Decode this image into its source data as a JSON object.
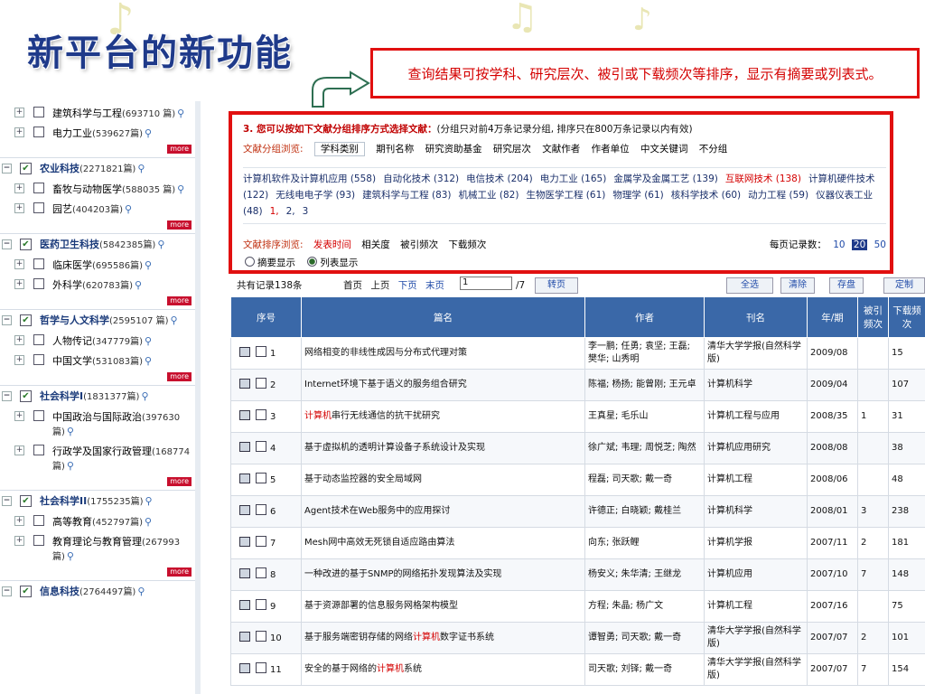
{
  "slide": {
    "title": "新平台的新功能",
    "callout": "查询结果可按学科、研究层次、被引或下载频次等排序，显示有摘要或列表式。"
  },
  "sidebar": {
    "items": [
      {
        "type": "sub",
        "name": "建筑科学与工程",
        "count": "(693710 篇)"
      },
      {
        "type": "sub",
        "name": "电力工业",
        "count": "(539627篇)"
      },
      {
        "type": "more",
        "label": "more"
      },
      {
        "type": "cat",
        "name": "农业科技",
        "count": "(2271821篇)"
      },
      {
        "type": "sub",
        "name": "畜牧与动物医学",
        "count": "(588035 篇)"
      },
      {
        "type": "sub",
        "name": "园艺",
        "count": "(404203篇)"
      },
      {
        "type": "more",
        "label": "more"
      },
      {
        "type": "cat",
        "name": "医药卫生科技",
        "count": "(5842385篇)"
      },
      {
        "type": "sub",
        "name": "临床医学",
        "count": "(695586篇)"
      },
      {
        "type": "sub",
        "name": "外科学",
        "count": "(620783篇)"
      },
      {
        "type": "more",
        "label": "more"
      },
      {
        "type": "cat",
        "name": "哲学与人文科学",
        "count": "(2595107 篇)"
      },
      {
        "type": "sub",
        "name": "人物传记",
        "count": "(347779篇)"
      },
      {
        "type": "sub",
        "name": "中国文学",
        "count": "(531083篇)"
      },
      {
        "type": "more",
        "label": "more"
      },
      {
        "type": "cat",
        "name": "社会科学I",
        "count": "(1831377篇)"
      },
      {
        "type": "sub",
        "name": "中国政治与国际政治",
        "count": "(397630 篇)"
      },
      {
        "type": "sub",
        "name": "行政学及国家行政管理",
        "count": "(168774篇)"
      },
      {
        "type": "more",
        "label": "more"
      },
      {
        "type": "cat",
        "name": "社会科学II",
        "count": "(1755235篇)"
      },
      {
        "type": "sub",
        "name": "高等教育",
        "count": "(452797篇)"
      },
      {
        "type": "sub",
        "name": "教育理论与教育管理",
        "count": "(267993 篇)"
      },
      {
        "type": "more",
        "label": "more"
      },
      {
        "type": "cat",
        "name": "信息科技",
        "count": "(2764497篇)"
      }
    ]
  },
  "panel": {
    "header_bold": "3. 您可以按如下文献分组排序方式选择文献：",
    "header_note": "(分组只对前4万条记录分组, 排序只在800万条记录以内有效)",
    "group_label": "文献分组浏览:",
    "group_tabs": [
      "学科类别",
      "期刊名称",
      "研究资助基金",
      "研究层次",
      "文献作者",
      "作者单位",
      "中文关键词",
      "不分组"
    ],
    "topics": [
      {
        "t": "计算机软件及计算机应用 (558)",
        "hl": false
      },
      {
        "t": "自动化技术 (312)",
        "hl": false
      },
      {
        "t": "电信技术 (204)",
        "hl": false
      },
      {
        "t": "电力工业 (165)",
        "hl": false
      },
      {
        "t": "金属学及金属工艺 (139)",
        "hl": false
      },
      {
        "t": "互联网技术 (138)",
        "hl": true
      },
      {
        "t": "计算机硬件技术 (122)",
        "hl": false
      },
      {
        "t": "无线电电子学 (93)",
        "hl": false
      },
      {
        "t": "建筑科学与工程 (83)",
        "hl": false
      },
      {
        "t": "机械工业 (82)",
        "hl": false
      },
      {
        "t": "生物医学工程 (61)",
        "hl": false
      },
      {
        "t": "物理学 (61)",
        "hl": false
      },
      {
        "t": "核科学技术 (60)",
        "hl": false
      },
      {
        "t": "动力工程 (59)",
        "hl": false
      },
      {
        "t": "仪器仪表工业 (48)",
        "hl": false
      },
      {
        "t": "1,",
        "hl": true
      },
      {
        "t": "2,",
        "hl": false
      },
      {
        "t": "3",
        "hl": false
      }
    ],
    "sort_label": "文献排序浏览:",
    "sort_options": [
      "发表时间",
      "相关度",
      "被引频次",
      "下载频次"
    ],
    "per_page_label": "每页记录数：",
    "per_page_options": [
      "10",
      "20",
      "50"
    ],
    "per_page_selected": "20",
    "view_abstract": "摘要显示",
    "view_list": "列表显示"
  },
  "pager": {
    "total": "共有记录138条",
    "first": "首页",
    "prev": "上页",
    "next": "下页",
    "last": "末页",
    "page_value": "1",
    "of": "/7",
    "go": "转页",
    "select_all": "全选",
    "clear": "清除",
    "save": "存盘",
    "custom": "定制"
  },
  "table": {
    "headers": [
      "序号",
      "篇名",
      "作者",
      "刊名",
      "年/期",
      "被引频次",
      "下载频次"
    ],
    "rows": [
      {
        "no": "1",
        "pre": "",
        "hl": "",
        "post": "网络相变的非线性成因与分布式代理对策",
        "authors": "李一鹏; 任勇; 袁坚; 王磊; 樊华; 山秀明",
        "journal": "清华大学学报(自然科学版)",
        "issue": "2009/08",
        "cited": "",
        "dl": "15"
      },
      {
        "no": "2",
        "pre": "",
        "hl": "",
        "post": "Internet环境下基于语义的服务组合研究",
        "authors": "陈福; 杨扬; 能曾刚; 王元卓",
        "journal": "计算机科学",
        "issue": "2009/04",
        "cited": "",
        "dl": "107"
      },
      {
        "no": "3",
        "pre": "",
        "hl": "计算机",
        "post": "串行无线通信的抗干扰研究",
        "authors": "王真星; 毛乐山",
        "journal": "计算机工程与应用",
        "issue": "2008/35",
        "cited": "1",
        "dl": "31"
      },
      {
        "no": "4",
        "pre": "",
        "hl": "",
        "post": "基于虚拟机的透明计算设备子系统设计及实现",
        "authors": "徐广斌; 韦理; 周悦芝; 陶然",
        "journal": "计算机应用研究",
        "issue": "2008/08",
        "cited": "",
        "dl": "38"
      },
      {
        "no": "5",
        "pre": "",
        "hl": "",
        "post": "基于动态监控器的安全局域网",
        "authors": "程磊; 司天歌; 戴一奇",
        "journal": "计算机工程",
        "issue": "2008/06",
        "cited": "",
        "dl": "48"
      },
      {
        "no": "6",
        "pre": "",
        "hl": "",
        "post": "Agent技术在Web服务中的应用探讨",
        "authors": "许德正; 白晓颖; 戴桂兰",
        "journal": "计算机科学",
        "issue": "2008/01",
        "cited": "3",
        "dl": "238"
      },
      {
        "no": "7",
        "pre": "",
        "hl": "",
        "post": "Mesh网中高效无死锁自适应路由算法",
        "authors": "向东; 张跃鲤",
        "journal": "计算机学报",
        "issue": "2007/11",
        "cited": "2",
        "dl": "181"
      },
      {
        "no": "8",
        "pre": "",
        "hl": "",
        "post": "一种改进的基于SNMP的网络拓扑发现算法及实现",
        "authors": "杨安义; 朱华清; 王继龙",
        "journal": "计算机应用",
        "issue": "2007/10",
        "cited": "7",
        "dl": "148"
      },
      {
        "no": "9",
        "pre": "",
        "hl": "",
        "post": "基于资源部署的信息服务网格架构模型",
        "authors": "方程; 朱晶; 杨广文",
        "journal": "计算机工程",
        "issue": "2007/16",
        "cited": "",
        "dl": "75"
      },
      {
        "no": "10",
        "pre": "基于服务端密钥存储的网络",
        "hl": "计算机",
        "post": "数字证书系统",
        "authors": "谭智勇; 司天歌; 戴一奇",
        "journal": "清华大学学报(自然科学版)",
        "issue": "2007/07",
        "cited": "2",
        "dl": "101"
      },
      {
        "no": "11",
        "pre": "安全的基于网络的",
        "hl": "计算机",
        "post": "系统",
        "authors": "司天歌; 刘铎; 戴一奇",
        "journal": "清华大学学报(自然科学版)",
        "issue": "2007/07",
        "cited": "7",
        "dl": "154"
      }
    ]
  },
  "colors": {
    "title": "#1f3a8a",
    "highlight_red": "#e11010",
    "table_header": "#3a68a8",
    "more_badge": "#c8102e"
  }
}
